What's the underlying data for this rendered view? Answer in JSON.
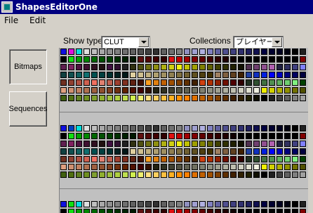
{
  "window": {
    "title": "ShapesEditorOne"
  },
  "menu": [
    "File",
    "Edit"
  ],
  "sidebar": {
    "bitmaps_label": "Bitmaps",
    "sequences_label": "Sequences"
  },
  "toolbar": {
    "show_type_label": "Show type",
    "show_type_value": "CLUT",
    "collections_label": "Collections",
    "collections_value": "プレイヤー"
  },
  "cluts": [
    {
      "rows": [
        [
          "#1010e0",
          "#e010e0",
          "#00e0e0",
          "#e0e0e0",
          "#c0c0c0",
          "#a8a8a8",
          "#909090",
          "#808080",
          "#707070",
          "#606060",
          "#505050",
          "#404040",
          "#303030",
          "#606060",
          "#707070",
          "#808080",
          "#9090c0",
          "#a0a0d0",
          "#b0b0e0",
          "#8080c0",
          "#6060a0",
          "#505090",
          "#404080",
          "#303070",
          "#202060",
          "#101050",
          "#000040",
          "#000030",
          "#000020",
          "#000010",
          "#000000",
          "#202020"
        ],
        [
          "#000000",
          "#10e010",
          "#00a000",
          "#008800",
          "#006800",
          "#005000",
          "#004000",
          "#003000",
          "#002000",
          "#001800",
          "#601010",
          "#500808",
          "#400000",
          "#300000",
          "#e01010",
          "#c00000",
          "#a00000",
          "#800000",
          "#600000",
          "#400000",
          "#300000",
          "#200000",
          "#100000",
          "#000000",
          "#000000",
          "#000000",
          "#000000",
          "#000000",
          "#000000",
          "#000000",
          "#000000",
          "#800000"
        ],
        [
          "#602050",
          "#802060",
          "#501040",
          "#401030",
          "#301020",
          "#201010",
          "#401040",
          "#301030",
          "#202020",
          "#303010",
          "#505010",
          "#707010",
          "#909010",
          "#b0b010",
          "#d0d010",
          "#f0f010",
          "#c0c000",
          "#a0a000",
          "#808000",
          "#606000",
          "#404000",
          "#303000",
          "#202000",
          "#101000",
          "#503050",
          "#704070",
          "#905090",
          "#b060b0",
          "#202040",
          "#303060",
          "#404080",
          "#8080ff"
        ],
        [
          "#104040",
          "#105050",
          "#106060",
          "#107070",
          "#005050",
          "#004040",
          "#003030",
          "#002020",
          "#001818",
          "#e0d0a0",
          "#d0c090",
          "#c0b080",
          "#b0a070",
          "#a09060",
          "#908050",
          "#807040",
          "#706030",
          "#605020",
          "#504010",
          "#403000",
          "#a08060",
          "#806040",
          "#604020",
          "#402000",
          "#2040a0",
          "#1030c0",
          "#0020e0",
          "#0000ff",
          "#0000c0",
          "#000080",
          "#000060",
          "#000040"
        ],
        [
          "#703020",
          "#904030",
          "#b05040",
          "#d06050",
          "#f07060",
          "#e08070",
          "#c06050",
          "#a04030",
          "#803020",
          "#602010",
          "#401000",
          "#ffa020",
          "#e08010",
          "#c06000",
          "#a05000",
          "#804000",
          "#603000",
          "#402000",
          "#d04010",
          "#b03000",
          "#902000",
          "#701000",
          "#500000",
          "#300000",
          "#203020",
          "#305030",
          "#407040",
          "#509050",
          "#60b060",
          "#70d070",
          "#80f080",
          "#004000"
        ],
        [
          "#e0a080",
          "#d09070",
          "#c08060",
          "#b07050",
          "#a06040",
          "#905030",
          "#804020",
          "#703010",
          "#602000",
          "#501000",
          "#400000",
          "#301000",
          "#202010",
          "#303020",
          "#404030",
          "#505040",
          "#606050",
          "#707060",
          "#808070",
          "#909080",
          "#a0a090",
          "#b0b0a0",
          "#c0c0b0",
          "#d0d0c0",
          "#e0e0d0",
          "#f0f0e0",
          "#f0f000",
          "#d0d000",
          "#b0b000",
          "#909000",
          "#707000",
          "#505000"
        ],
        [
          "#406010",
          "#507010",
          "#608020",
          "#709020",
          "#80a030",
          "#90b030",
          "#a0c040",
          "#b0d040",
          "#c0e050",
          "#d0f050",
          "#f0f070",
          "#ffe080",
          "#ffd060",
          "#ffc040",
          "#ffb020",
          "#ff9000",
          "#ff8000",
          "#e07000",
          "#c06000",
          "#a05000",
          "#804000",
          "#603000",
          "#402000",
          "#302000",
          "#202000",
          "#101000",
          "#000000",
          "#202020",
          "#404040",
          "#606060",
          "#808080",
          "#a0a0a0"
        ]
      ]
    },
    {
      "rows": [
        [
          "#1010e0",
          "#0040c0",
          "#00e0e0",
          "#e0e0e0",
          "#c0c0c0",
          "#a8a8a8",
          "#909090",
          "#808080",
          "#707070",
          "#606060",
          "#505050",
          "#404040",
          "#303030",
          "#606060",
          "#707070",
          "#808080",
          "#9090c0",
          "#a0a0d0",
          "#b0b0e0",
          "#8080c0",
          "#6060a0",
          "#505090",
          "#404080",
          "#303070",
          "#202060",
          "#101050",
          "#000040",
          "#000030",
          "#000020",
          "#000010",
          "#000000",
          "#202020"
        ],
        [
          "#000000",
          "#10e010",
          "#00a000",
          "#008800",
          "#006800",
          "#005000",
          "#004000",
          "#003000",
          "#002000",
          "#001800",
          "#601010",
          "#500808",
          "#400000",
          "#300000",
          "#e01010",
          "#c00000",
          "#a00000",
          "#800000",
          "#600000",
          "#400000",
          "#300000",
          "#200000",
          "#100000",
          "#000000",
          "#000000",
          "#000000",
          "#000000",
          "#000000",
          "#000000",
          "#000000",
          "#000000",
          "#800000"
        ],
        [
          "#602050",
          "#802060",
          "#501040",
          "#401030",
          "#301020",
          "#201010",
          "#401040",
          "#301030",
          "#202020",
          "#303010",
          "#505010",
          "#707010",
          "#909010",
          "#b0b010",
          "#d0d010",
          "#f0f010",
          "#c0c000",
          "#a0a000",
          "#808000",
          "#606000",
          "#404000",
          "#303000",
          "#202000",
          "#101000",
          "#503050",
          "#704070",
          "#905090",
          "#b060b0",
          "#202040",
          "#303060",
          "#404080",
          "#8080ff"
        ],
        [
          "#104040",
          "#105050",
          "#106060",
          "#107070",
          "#005050",
          "#004040",
          "#003030",
          "#002020",
          "#001818",
          "#e0d0a0",
          "#d0c090",
          "#c0b080",
          "#b0a070",
          "#a09060",
          "#908050",
          "#807040",
          "#706030",
          "#605020",
          "#504010",
          "#403000",
          "#a08060",
          "#806040",
          "#604020",
          "#402000",
          "#2040a0",
          "#1030c0",
          "#0020e0",
          "#0000ff",
          "#0000c0",
          "#000080",
          "#000060",
          "#000040"
        ],
        [
          "#703020",
          "#904030",
          "#b05040",
          "#d06050",
          "#f07060",
          "#e08070",
          "#c06050",
          "#a04030",
          "#803020",
          "#602010",
          "#401000",
          "#ffa020",
          "#e08010",
          "#c06000",
          "#a05000",
          "#804000",
          "#603000",
          "#402000",
          "#d04010",
          "#b03000",
          "#902000",
          "#701000",
          "#500000",
          "#300000",
          "#203020",
          "#305030",
          "#407040",
          "#509050",
          "#60b060",
          "#70d070",
          "#80f080",
          "#004000"
        ],
        [
          "#e0a080",
          "#d09070",
          "#c08060",
          "#b07050",
          "#a06040",
          "#905030",
          "#804020",
          "#703010",
          "#602000",
          "#501000",
          "#400000",
          "#301000",
          "#202010",
          "#303020",
          "#404030",
          "#505040",
          "#606050",
          "#707060",
          "#808070",
          "#909080",
          "#a0a090",
          "#b0b0a0",
          "#c0c0b0",
          "#d0d0c0",
          "#e0e0d0",
          "#f0f0e0",
          "#f0f000",
          "#d0d000",
          "#b0b000",
          "#909000",
          "#707000",
          "#505000"
        ],
        [
          "#406010",
          "#507010",
          "#608020",
          "#709020",
          "#80a030",
          "#90b030",
          "#a0c040",
          "#b0d040",
          "#c0e050",
          "#d0f050",
          "#f0f070",
          "#ffe080",
          "#ffd060",
          "#ffc040",
          "#ffb020",
          "#ff9000",
          "#ff8000",
          "#e07000",
          "#c06000",
          "#a05000",
          "#804000",
          "#603000",
          "#402000",
          "#302000",
          "#202000",
          "#101000",
          "#000000",
          "#202020",
          "#404040",
          "#606060",
          "#808080",
          "#a0a0a0"
        ]
      ]
    },
    {
      "rows": [
        [
          "#1010e0",
          "#10e010",
          "#00e0e0",
          "#e0e0e0",
          "#c0c0c0",
          "#a8a8a8",
          "#909090",
          "#808080",
          "#707070",
          "#606060",
          "#505050",
          "#404040",
          "#303030",
          "#606060",
          "#707070",
          "#808080",
          "#9090c0",
          "#a0a0d0",
          "#b0b0e0",
          "#8080c0",
          "#6060a0",
          "#505090",
          "#404080",
          "#303070",
          "#202060",
          "#101050",
          "#000040",
          "#000030",
          "#000020",
          "#000010",
          "#000000",
          "#202020"
        ],
        [
          "#000000",
          "#10e010",
          "#00a000",
          "#008800",
          "#006800",
          "#005000",
          "#004000",
          "#003000",
          "#002000",
          "#001800",
          "#601010",
          "#500808",
          "#400000",
          "#300000",
          "#e01010",
          "#c00000",
          "#a00000",
          "#800000",
          "#600000",
          "#400000",
          "#300000",
          "#200000",
          "#100000",
          "#000000",
          "#000000",
          "#000000",
          "#000000",
          "#000000",
          "#000000",
          "#000000",
          "#000000",
          "#800000"
        ]
      ]
    }
  ]
}
